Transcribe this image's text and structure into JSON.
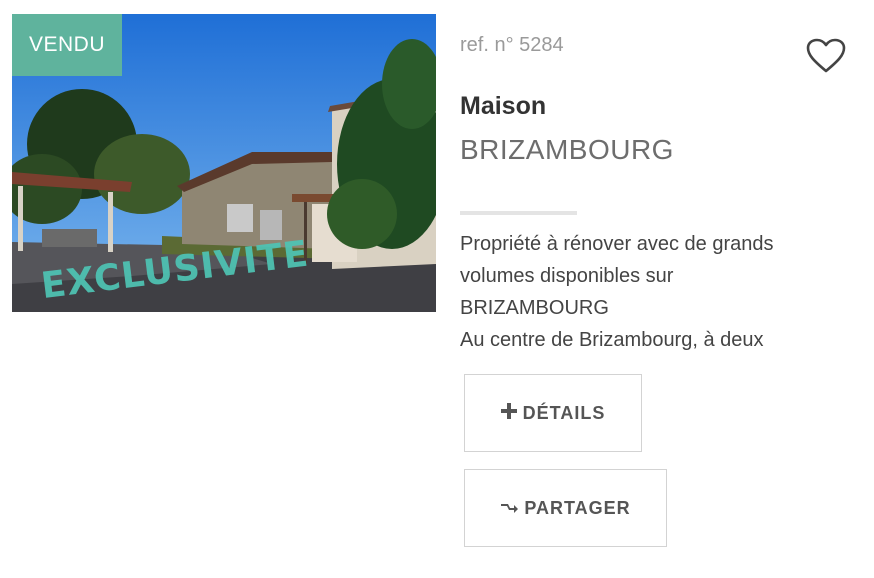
{
  "listing": {
    "status_badge": "VENDU",
    "photo_watermark": "EXCLUSIVITE",
    "reference": "ref. n° 5284",
    "property_type": "Maison",
    "city": "BRIZAMBOURG",
    "description_lines": [
      "Propriété à rénover avec de grands",
      "volumes disponibles sur",
      "BRIZAMBOURG",
      "Au centre de Brizambourg, à deux"
    ]
  },
  "actions": {
    "favorite_icon": "heart-outline-icon",
    "details_icon": "plus-icon",
    "details_label": "DÉTAILS",
    "share_icon": "arrow-right-icon",
    "share_label": "PARTAGER"
  },
  "colors": {
    "badge": "#5fb39d",
    "watermark": "#4ec4b4",
    "text_muted": "#9a9a9a",
    "text_dark": "#333333"
  }
}
